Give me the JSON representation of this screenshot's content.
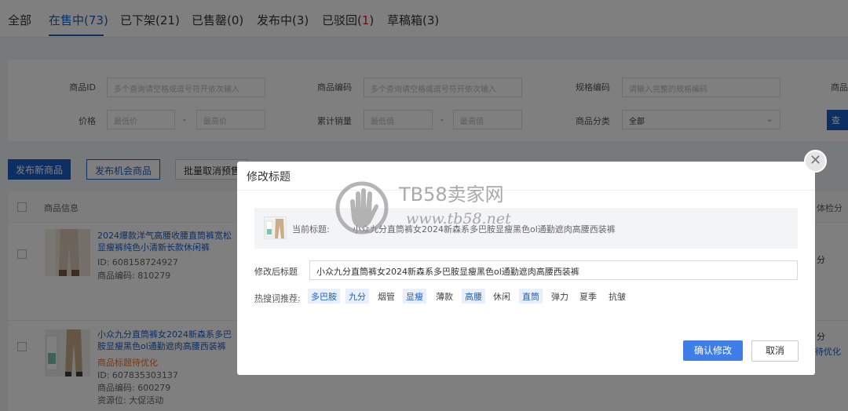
{
  "tabs": [
    {
      "label": "全部",
      "active": false
    },
    {
      "label": "在售中(73)",
      "active": true
    },
    {
      "label": "已下架(21)",
      "active": false
    },
    {
      "label": "已售罄(0)",
      "active": false
    },
    {
      "label": "发布中(3)",
      "active": false
    },
    {
      "label": "已驳回(",
      "count": "1",
      "suffix": ")",
      "active": false
    },
    {
      "label": "草稿箱(3)",
      "active": false
    }
  ],
  "filters": {
    "product_id_label": "商品ID",
    "product_id_placeholder": "多个查询请空格或逗号符开依次输入",
    "product_code_label": "商品编码",
    "product_code_placeholder": "多个查询请空格或逗号符开依次输入",
    "spec_code_label": "规格编码",
    "spec_code_placeholder": "请输入完整的规格编码",
    "extra_label": "商品",
    "price_label": "价格",
    "price_min_placeholder": "最低价",
    "price_max_placeholder": "最高价",
    "sales_label": "累计销量",
    "sales_min_placeholder": "最低值",
    "sales_max_placeholder": "最高值",
    "category_label": "商品分类",
    "category_value": "全部",
    "dash": "-",
    "search_button": "查"
  },
  "actions": {
    "publish_new": "发布新商品",
    "publish_opportunity": "发布机会商品",
    "batch_cancel": "批量取消预售"
  },
  "table": {
    "header_product_info": "商品信息",
    "header_right": "体检分",
    "rows": [
      {
        "title": "2024爆款洋气高腰收腰直筒裤宽松显瘦裤纯色小清新长款休闲裤",
        "id": "ID: 608158724927",
        "code": "商品编码: 810279",
        "right_text": "分",
        "right_sub": ""
      },
      {
        "title": "小众九分直筒裤女2024新森系多巴胺显瘦黑色ol通勤遮肉高腰西装裤",
        "warn": "商品标题待优化",
        "id": "ID: 607835303137",
        "code": "商品编码: 600279",
        "resource": "资源位: 大促活动",
        "right_text": "分",
        "right_sub": "待优化"
      }
    ]
  },
  "modal": {
    "title": "修改标题",
    "current_label": "当前标题:",
    "current_title": "小众九分直筒裤女2024新森系多巴胺显瘦黑色ol通勤遮肉高腰西装裤",
    "edit_label": "修改后标题",
    "edit_value": "小众九分直筒裤女2024新森系多巴胺显瘦黑色ol通勤遮肉高腰西装裤",
    "hot_label": "热搜词推荐:",
    "hot_words": [
      {
        "word": "多巴胺",
        "highlighted": true
      },
      {
        "word": "九分",
        "highlighted": true
      },
      {
        "word": "烟管",
        "highlighted": false
      },
      {
        "word": "显瘦",
        "highlighted": true
      },
      {
        "word": "薄款",
        "highlighted": false
      },
      {
        "word": "高腰",
        "highlighted": true
      },
      {
        "word": "休闲",
        "highlighted": false
      },
      {
        "word": "直筒",
        "highlighted": true
      },
      {
        "word": "弹力",
        "highlighted": false
      },
      {
        "word": "夏季",
        "highlighted": false
      },
      {
        "word": "抗皱",
        "highlighted": false
      }
    ],
    "confirm": "确认修改",
    "cancel": "取消",
    "close_glyph": "✕"
  },
  "watermark": {
    "line1": "TB58卖家网",
    "line2": "www.tb58.net"
  },
  "colors": {
    "primary": "#1d5ec7",
    "confirm": "#3f7ee8",
    "warn": "#e8742c",
    "chip_bg": "#e8f0fd"
  }
}
